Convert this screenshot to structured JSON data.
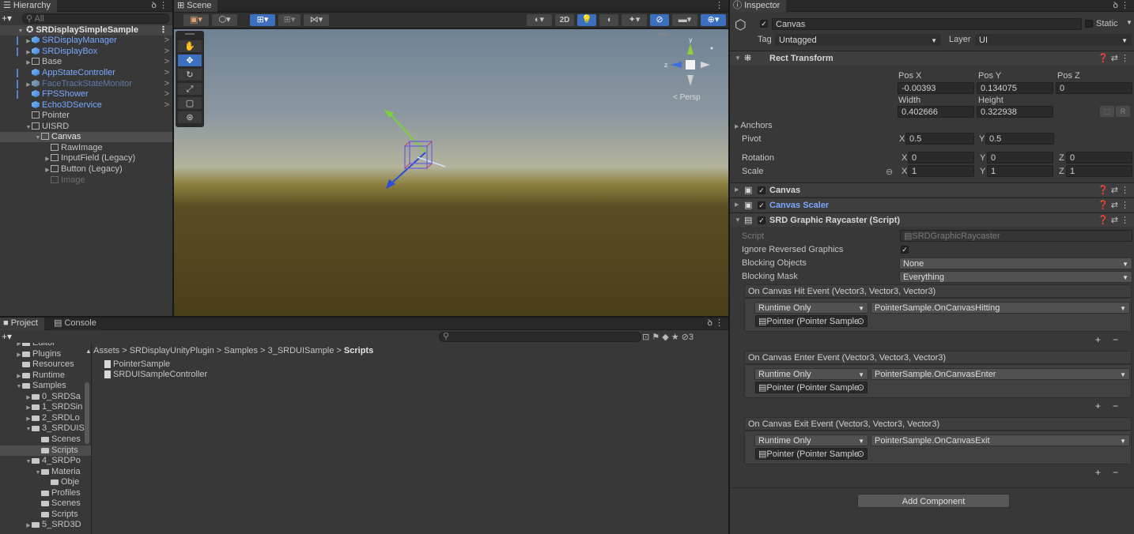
{
  "hierarchy": {
    "tab": "Hierarchy",
    "search_placeholder": "All",
    "scene": "SRDisplaySimpleSample",
    "items": [
      {
        "label": "SRDisplayManager",
        "kind": "prefab"
      },
      {
        "label": "SRDisplayBox",
        "kind": "prefab"
      },
      {
        "label": "Base",
        "kind": "normal"
      },
      {
        "label": "AppStateController",
        "kind": "prefab"
      },
      {
        "label": "FaceTrackStateMonitor",
        "kind": "prefab-dim"
      },
      {
        "label": "FPSShower",
        "kind": "prefab"
      },
      {
        "label": "Echo3DService",
        "kind": "prefab"
      },
      {
        "label": "Pointer",
        "kind": "normal"
      },
      {
        "label": "UISRD",
        "kind": "normal"
      },
      {
        "label": "Canvas",
        "kind": "selected"
      },
      {
        "label": "RawImage",
        "kind": "normal"
      },
      {
        "label": "InputField (Legacy)",
        "kind": "normal"
      },
      {
        "label": "Button (Legacy)",
        "kind": "normal"
      },
      {
        "label": "Image",
        "kind": "dim"
      }
    ]
  },
  "scene": {
    "tab": "Scene",
    "mode_2d": "2D",
    "persp_label": "< Persp",
    "gizmo_y": "y",
    "gizmo_z": "z"
  },
  "project": {
    "tab_project": "Project",
    "tab_console": "Console",
    "badge_count": "3",
    "breadcrumb": [
      "Assets",
      "SRDisplayUnityPlugin",
      "Samples",
      "3_SRDUISample",
      "Scripts"
    ],
    "tree": [
      "Editor",
      "Plugins",
      "Resources",
      "Runtime",
      "Samples",
      "0_SRDSa",
      "1_SRDSin",
      "2_SRDLo",
      "3_SRDUIS",
      "Scenes",
      "Scripts",
      "4_SRDPo",
      "Materia",
      "Obje",
      "Profiles",
      "Scenes",
      "Scripts",
      "5_SRD3D"
    ],
    "files": [
      "PointerSample",
      "SRDUISampleController"
    ]
  },
  "inspector": {
    "tab": "Inspector",
    "object_name": "Canvas",
    "static_label": "Static",
    "tag_label": "Tag",
    "tag_value": "Untagged",
    "layer_label": "Layer",
    "layer_value": "UI",
    "rect_transform": "Rect Transform",
    "pos_x_label": "Pos X",
    "pos_y_label": "Pos Y",
    "pos_z_label": "Pos Z",
    "pos_x": "-0.00393",
    "pos_y": "0.134075",
    "pos_z": "0",
    "width_label": "Width",
    "height_label": "Height",
    "width": "0.402666",
    "height": "0.322938",
    "anchors": "Anchors",
    "pivot": "Pivot",
    "pivot_x": "0.5",
    "pivot_y": "0.5",
    "rotation": "Rotation",
    "rot_x": "0",
    "rot_y": "0",
    "rot_z": "0",
    "scale": "Scale",
    "scale_x": "1",
    "scale_y": "1",
    "scale_z": "1",
    "x": "X",
    "y": "Y",
    "z": "Z",
    "r_btn": "R",
    "comp_canvas": "Canvas",
    "comp_scaler": "Canvas Scaler",
    "comp_raycaster": "SRD Graphic Raycaster (Script)",
    "script_label": "Script",
    "script_value": "SRDGraphicRaycaster",
    "ignore_reversed": "Ignore Reversed Graphics",
    "blocking_objects": "Blocking Objects",
    "blocking_objects_value": "None",
    "blocking_mask": "Blocking Mask",
    "blocking_mask_value": "Everything",
    "events": [
      {
        "title": "On Canvas Hit Event (Vector3, Vector3, Vector3)",
        "mode": "Runtime Only",
        "func": "PointerSample.OnCanvasHitting",
        "object": "Pointer (Pointer Sample"
      },
      {
        "title": "On Canvas Enter Event (Vector3, Vector3, Vector3)",
        "mode": "Runtime Only",
        "func": "PointerSample.OnCanvasEnter",
        "object": "Pointer (Pointer Sample"
      },
      {
        "title": "On Canvas Exit Event (Vector3, Vector3, Vector3)",
        "mode": "Runtime Only",
        "func": "PointerSample.OnCanvasExit",
        "object": "Pointer (Pointer Sample"
      }
    ],
    "add_component": "Add Component"
  },
  "colors": {
    "prefab": "#7aa8ff",
    "selection": "#4d4d4d",
    "accent": "#3d6fbf"
  }
}
